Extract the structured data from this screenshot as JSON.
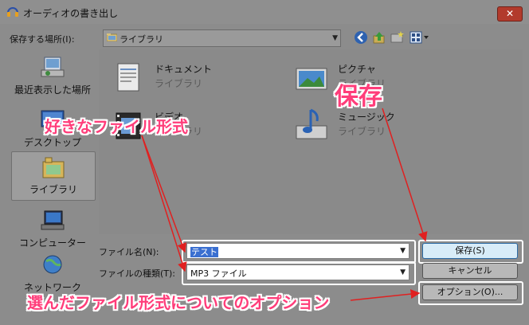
{
  "window": {
    "title": "オーディオの書き出し",
    "close_glyph": "✕"
  },
  "toolbar": {
    "save_in_label": "保存する場所(I):",
    "location": "ライブラリ",
    "dropdown_glyph": "▼"
  },
  "places": [
    {
      "label": "最近表示した場所",
      "icon": "recent-places-icon"
    },
    {
      "label": "デスクトップ",
      "icon": "desktop-icon"
    },
    {
      "label": "ライブラリ",
      "icon": "libraries-icon",
      "selected": true
    },
    {
      "label": "コンピューター",
      "icon": "computer-icon"
    },
    {
      "label": "ネットワーク",
      "icon": "network-icon"
    }
  ],
  "libraries": [
    {
      "name": "ドキュメント",
      "type": "ライブラリ",
      "icon": "documents-library-icon"
    },
    {
      "name": "ピクチャ",
      "type": "ライブラリ",
      "icon": "pictures-library-icon"
    },
    {
      "name": "ビデオ",
      "type": "ライブラリ",
      "icon": "videos-library-icon"
    },
    {
      "name": "ミュージック",
      "type": "ライブラリ",
      "icon": "music-library-icon"
    }
  ],
  "form": {
    "filename_label": "ファイル名(N):",
    "filename_value": "テスト",
    "filetype_label": "ファイルの種類(T):",
    "filetype_value": "MP3 ファイル"
  },
  "buttons": {
    "save": "保存(S)",
    "cancel": "キャンセル",
    "options": "オプション(O)..."
  },
  "annotations": {
    "format": "好きなファイル形式",
    "save": "保存",
    "options": "選んだファイル形式についてのオプション"
  },
  "colors": {
    "annotation_text": "#ff3d7a",
    "annotation_outline": "#ffffff",
    "arrow": "#e02020"
  }
}
